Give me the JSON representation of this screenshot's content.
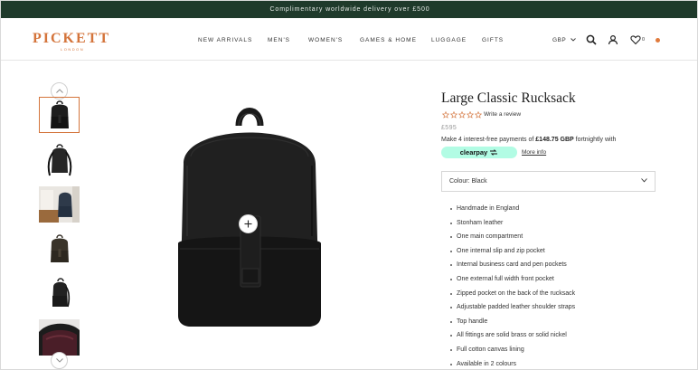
{
  "announcement": "Complimentary worldwide delivery over £500",
  "header": {
    "logo": "PICKETT",
    "logo_sub": "LONDON",
    "nav": [
      "NEW ARRIVALS",
      "MEN'S",
      "WOMEN'S",
      "GAMES & HOME",
      "LUGGAGE",
      "GIFTS"
    ],
    "currency": "GBP",
    "wishlist_count": "0",
    "icons": [
      "search-icon",
      "account-icon",
      "heart-icon",
      "cart-dot-icon"
    ]
  },
  "gallery": {
    "thumbnails": [
      "backpack front",
      "backpack back straps",
      "backpack lifestyle",
      "backpack dark",
      "backpack side",
      "backpack interior"
    ],
    "active_index": 0
  },
  "product": {
    "title": "Large Classic Rucksack",
    "review_link": "Write a review",
    "rating": 0,
    "price": "£595",
    "pay_prefix": "Make 4 interest-free payments of ",
    "pay_amount": "£148.75 GBP",
    "pay_suffix": " fortnightly with",
    "clearpay_label": "clearpay",
    "more_info": "More info",
    "colour_label": "Colour: Black",
    "features": [
      "Handmade in England",
      "Stonham leather",
      "One main compartment",
      "One internal slip and zip pocket",
      "Internal business card and pen pockets",
      "One external full width front pocket",
      "Zipped pocket on the back of the rucksack",
      "Adjustable padded leather shoulder straps",
      "Top handle",
      "All fittings are solid brass or solid nickel",
      "Full cotton canvas lining",
      "Available in 2 colours"
    ]
  },
  "colors": {
    "announcement_bg": "#1f3a2b",
    "brand_orange": "#d4743b",
    "clearpay_mint": "#b2fce4"
  }
}
